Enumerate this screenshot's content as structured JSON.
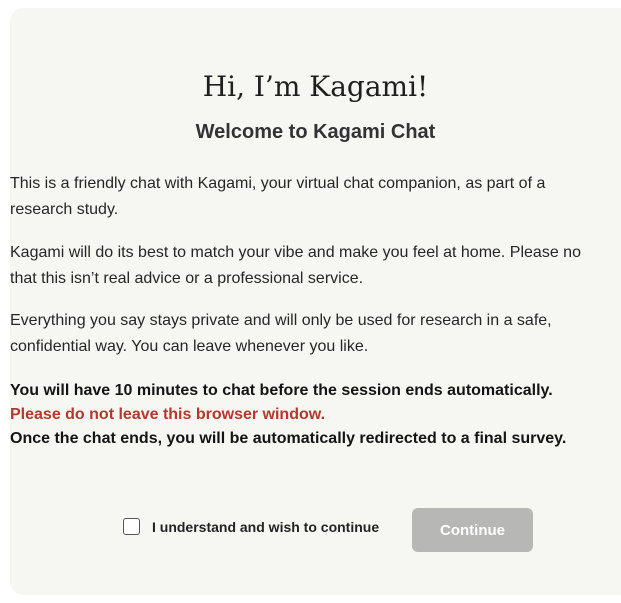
{
  "intro": {
    "title": "Hi, I’m Kagami!",
    "subtitle": "Welcome to Kagami Chat"
  },
  "paragraphs": {
    "p1_line1": "This is a friendly chat with Kagami, your virtual chat companion, as part of a",
    "p1_line2": "research study.",
    "p2_line1": "Kagami will do its best to match your vibe and make you feel at home. Please no",
    "p2_line2": "that this isn’t real advice or a professional service.",
    "p3_line1": "Everything you say stays private and will only be used for research in a safe,",
    "p3_line2": "confidential way. You can leave whenever you like."
  },
  "notices": {
    "time_limit": "You will have 10 minutes to chat before the session ends automatically.",
    "warning": "Please do not leave this browser window.",
    "redirect": "Once the chat ends, you will be automatically redirected to a final survey."
  },
  "consent": {
    "checkbox_label": "I understand and wish to continue",
    "checked": false
  },
  "actions": {
    "continue_label": "Continue",
    "continue_disabled": true
  },
  "colors": {
    "card_background": "#f6f6f2",
    "warning_text": "#b8362c",
    "disabled_button": "#b7b7b5"
  }
}
